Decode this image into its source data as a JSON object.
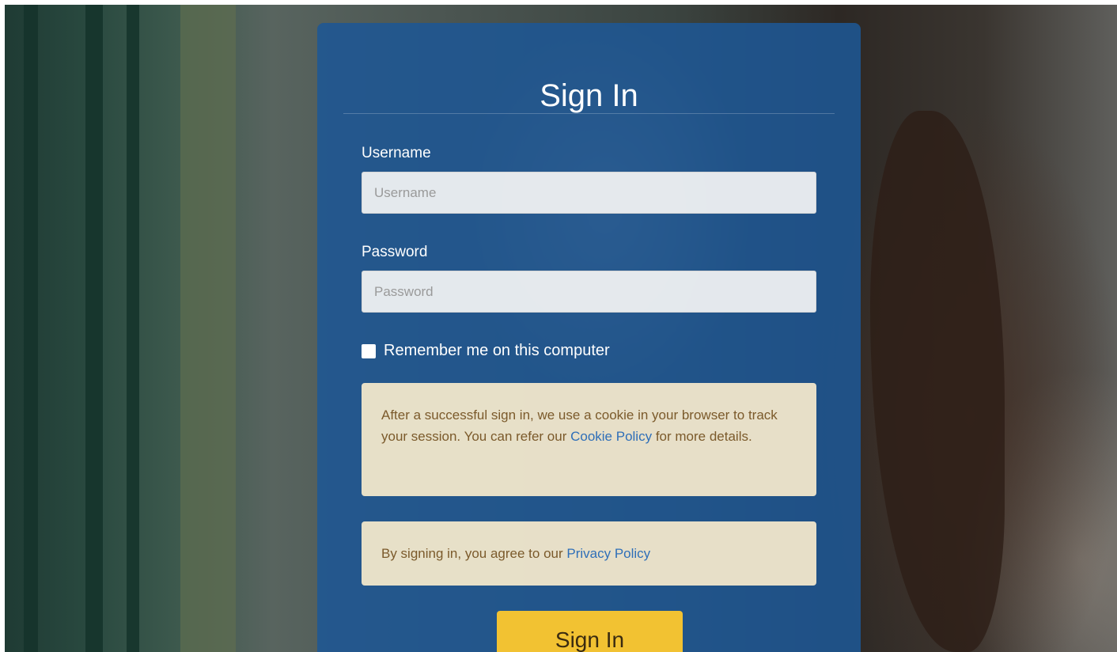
{
  "form": {
    "title": "Sign In",
    "username": {
      "label": "Username",
      "placeholder": "Username",
      "value": ""
    },
    "password": {
      "label": "Password",
      "placeholder": "Password",
      "value": ""
    },
    "remember": {
      "label": "Remember me on this computer",
      "checked": false
    },
    "cookie_notice": {
      "text_before": "After a successful sign in, we use a cookie in your browser to track your session. You can refer our ",
      "link": "Cookie Policy",
      "text_after": " for more details."
    },
    "privacy_notice": {
      "text_before": "By signing in, you agree to our ",
      "link": "Privacy Policy"
    },
    "submit_label": "Sign In"
  },
  "colors": {
    "panel": "#1e5694",
    "button": "#f2c232",
    "notice_bg": "#f8eccd",
    "notice_text": "#7b5a2b",
    "link": "#2f6fb8"
  }
}
